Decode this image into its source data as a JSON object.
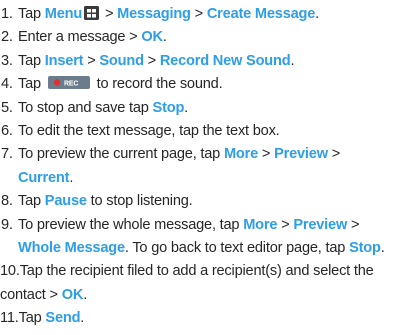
{
  "steps": [
    {
      "num": "1.",
      "parts": [
        {
          "t": "Tap ",
          "kw": false
        },
        {
          "t": "Menu",
          "kw": true
        },
        {
          "icon": "menu-grid-icon"
        },
        {
          "t": " > ",
          "kw": false
        },
        {
          "t": "Messaging",
          "kw": true
        },
        {
          "t": " > ",
          "kw": false
        },
        {
          "t": "Create Message",
          "kw": true
        },
        {
          "t": ".",
          "kw": false
        }
      ]
    },
    {
      "num": "2.",
      "parts": [
        {
          "t": "Enter a message > ",
          "kw": false
        },
        {
          "t": "OK",
          "kw": true
        },
        {
          "t": ".",
          "kw": false
        }
      ]
    },
    {
      "num": "3.",
      "parts": [
        {
          "t": "Tap ",
          "kw": false
        },
        {
          "t": "Insert",
          "kw": true
        },
        {
          "t": " > ",
          "kw": false
        },
        {
          "t": "Sound",
          "kw": true
        },
        {
          "t": " > ",
          "kw": false
        },
        {
          "t": "Record New Sound",
          "kw": true
        },
        {
          "t": ".",
          "kw": false
        }
      ]
    },
    {
      "num": "4.",
      "parts": [
        {
          "t": "Tap ",
          "kw": false
        },
        {
          "icon": "record-button-icon"
        },
        {
          "t": " to record the sound.",
          "kw": false
        }
      ]
    },
    {
      "num": "5.",
      "parts": [
        {
          "t": "To stop and save tap ",
          "kw": false
        },
        {
          "t": "Stop",
          "kw": true
        },
        {
          "t": ".",
          "kw": false
        }
      ]
    },
    {
      "num": "6.",
      "parts": [
        {
          "t": "To edit the text message, tap the text box.",
          "kw": false
        }
      ]
    },
    {
      "num": "7.",
      "parts": [
        {
          "t": "To preview the current page, tap ",
          "kw": false
        },
        {
          "t": "More",
          "kw": true
        },
        {
          "t": " > ",
          "kw": false
        },
        {
          "t": "Preview",
          "kw": true
        },
        {
          "t": " >",
          "kw": false
        },
        {
          "br": true
        },
        {
          "t": "Current",
          "kw": true
        },
        {
          "t": ".",
          "kw": false
        }
      ]
    },
    {
      "num": "8.",
      "parts": [
        {
          "t": "Tap ",
          "kw": false
        },
        {
          "t": "Pause",
          "kw": true
        },
        {
          "t": " to stop listening.",
          "kw": false
        }
      ]
    },
    {
      "num": "9.",
      "parts": [
        {
          "t": "To preview the whole message, tap ",
          "kw": false
        },
        {
          "t": "More",
          "kw": true
        },
        {
          "t": " > ",
          "kw": false
        },
        {
          "t": "Preview",
          "kw": true
        },
        {
          "t": " >",
          "kw": false
        },
        {
          "br": true
        },
        {
          "t": "Whole Message",
          "kw": true
        },
        {
          "t": ". To go back to text editor page, tap ",
          "kw": false
        },
        {
          "t": "Stop",
          "kw": true
        },
        {
          "t": ".",
          "kw": false
        }
      ]
    },
    {
      "num": "10.",
      "parts": [
        {
          "t": "Tap the recipient filed to add a recipient(s) and select the",
          "kw": false
        },
        {
          "br": true
        },
        {
          "t": "contact > ",
          "kw": false
        },
        {
          "t": "OK",
          "kw": true
        },
        {
          "t": ".",
          "kw": false
        }
      ]
    },
    {
      "num": "11.",
      "parts": [
        {
          "t": "Tap ",
          "kw": false
        },
        {
          "t": "Send",
          "kw": true
        },
        {
          "t": ".",
          "kw": false
        }
      ]
    }
  ],
  "icons": {
    "record_label": "REC"
  },
  "colors": {
    "keyword": "#2e9ee6",
    "text": "#262626",
    "record_button": "#6b7d8c"
  }
}
